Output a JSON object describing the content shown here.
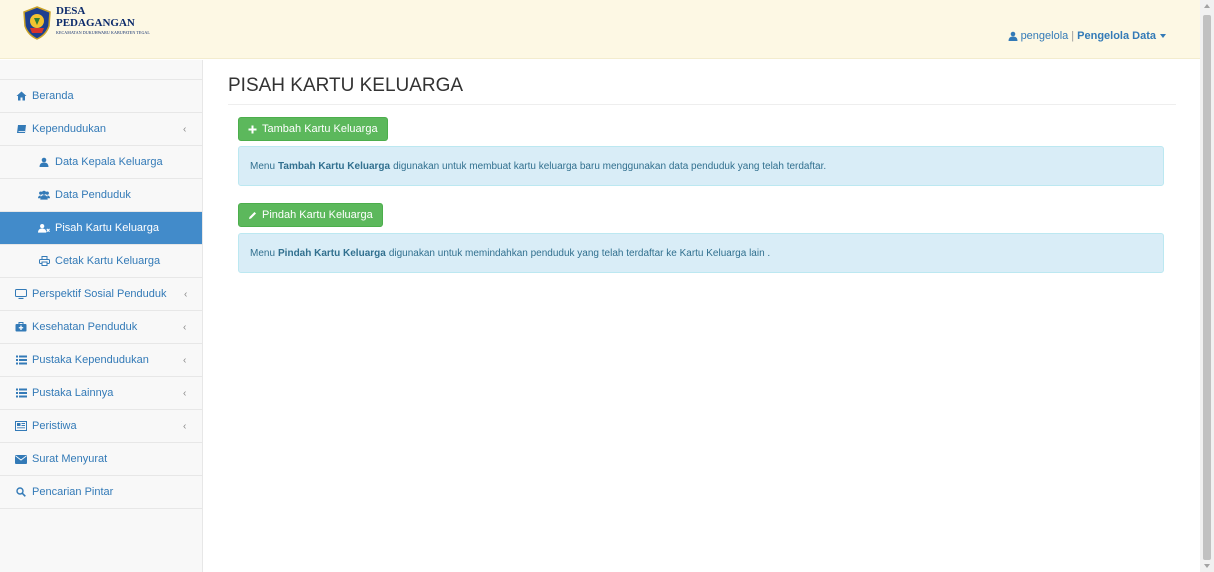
{
  "brand": {
    "line1": "DESA",
    "line2": "PEDAGANGAN",
    "line3": "KECAMATAN DUKUHWARU KABUPATEN TEGAL"
  },
  "user": {
    "name": "pengelola",
    "separator": "|",
    "role": "Pengelola Data"
  },
  "sidebar": {
    "items": [
      {
        "label": "Beranda",
        "icon": "home-icon"
      },
      {
        "label": "Kependudukan",
        "icon": "book-icon"
      },
      {
        "label": "Data Kepala Keluarga",
        "icon": "user-icon"
      },
      {
        "label": "Data Penduduk",
        "icon": "users-icon"
      },
      {
        "label": "Pisah Kartu Keluarga",
        "icon": "user-split-icon"
      },
      {
        "label": "Cetak Kartu Keluarga",
        "icon": "print-icon"
      },
      {
        "label": "Perspektif Sosial Penduduk",
        "icon": "monitor-icon"
      },
      {
        "label": "Kesehatan Penduduk",
        "icon": "medkit-icon"
      },
      {
        "label": "Pustaka Kependudukan",
        "icon": "list-icon"
      },
      {
        "label": "Pustaka Lainnya",
        "icon": "list-icon"
      },
      {
        "label": "Peristiwa",
        "icon": "newspaper-icon"
      },
      {
        "label": "Surat Menyurat",
        "icon": "envelope-icon"
      },
      {
        "label": "Pencarian Pintar",
        "icon": "search-icon"
      }
    ]
  },
  "main": {
    "title": "PISAH KARTU KELUARGA",
    "add_button": "Tambah Kartu Keluarga",
    "add_info": {
      "prefix": "Menu",
      "bold": "Tambah Kartu Keluarga",
      "suffix": "digunakan untuk membuat kartu keluarga baru menggunakan data penduduk yang telah terdaftar."
    },
    "move_button": "Pindah Kartu Keluarga",
    "move_info": {
      "prefix": "Menu",
      "bold": "Pindah Kartu Keluarga",
      "suffix": "digunakan untuk memindahkan penduduk yang telah terdaftar ke Kartu Keluarga lain ."
    }
  },
  "colors": {
    "navbar_bg": "#fdf8e4",
    "link": "#337ab7",
    "active_bg": "#428bca",
    "success": "#5cb85c",
    "info_bg": "#d9edf7"
  }
}
